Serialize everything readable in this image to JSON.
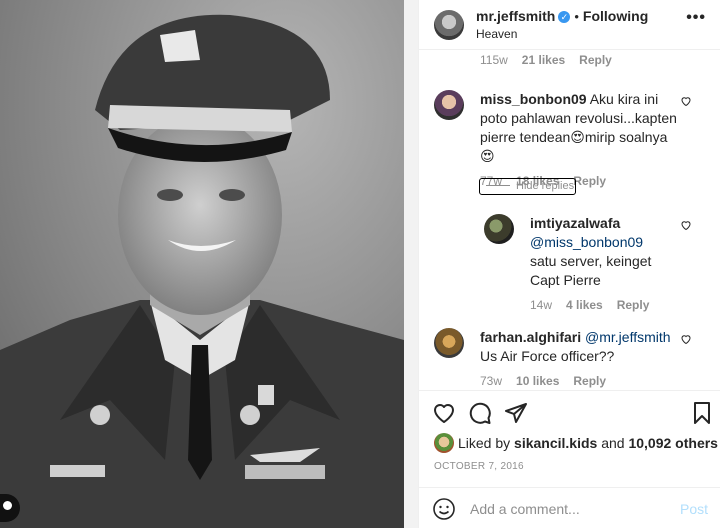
{
  "header": {
    "username": "mr.jeffsmith",
    "separator": "•",
    "follow_state": "Following",
    "location": "Heaven",
    "more_icon": "more-dots-icon"
  },
  "caption_meta": {
    "age": "115w",
    "likes": "21 likes",
    "reply": "Reply"
  },
  "comments": [
    {
      "username": "miss_bonbon09",
      "text": "Aku kira ini poto pahlawan revolusi...kapten pierre tendean😍mirip soalnya😍",
      "age": "77w",
      "likes": "18 likes",
      "reply": "Reply"
    },
    {
      "username": "imtiyazalwafa",
      "mention": "@miss_bonbon09",
      "text": " satu server, keinget Capt Pierre",
      "age": "14w",
      "likes": "4 likes",
      "reply": "Reply"
    },
    {
      "username": "farhan.alghifari",
      "mention": "@mr.jeffsmith",
      "text": " Us Air Force officer??",
      "age": "73w",
      "likes": "10 likes",
      "reply": "Reply"
    }
  ],
  "hide_replies_label": "Hide replies",
  "likes_summary": {
    "prefix": "Liked by ",
    "user": "sikancil.kids",
    "middle": " and ",
    "count": "10,092 others"
  },
  "post_date": "OCTOBER 7, 2016",
  "add_comment": {
    "placeholder": "Add a comment...",
    "post_label": "Post"
  },
  "colors": {
    "link": "#00376b",
    "post_disabled": "#b2dffc",
    "meta_gray": "#8e8e8e",
    "verified": "#3897f0"
  }
}
